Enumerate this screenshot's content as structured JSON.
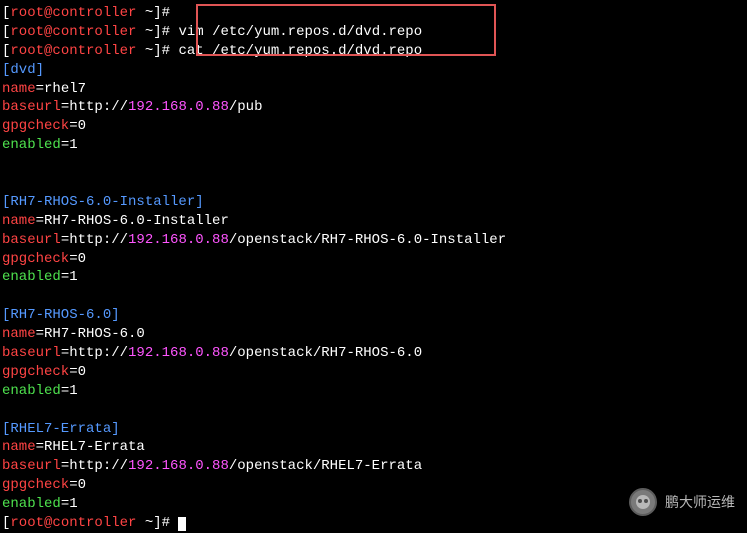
{
  "prompt": {
    "open_bracket": "[",
    "userhost": "root@controller",
    "tilde": " ~",
    "close_prompt": "]# "
  },
  "commands": {
    "empty": "",
    "vim": "vim /etc/yum.repos.d/dvd.repo",
    "cat": "cat /etc/yum.repos.d/dvd.repo"
  },
  "repos": [
    {
      "section": "[dvd]",
      "namekey": "name",
      "nameval": "=rhel7",
      "baseurlkey": "baseurl",
      "baseurlproto": "=http://",
      "baseurlip": "192.168.0.88",
      "baseurlpath": "/pub",
      "gpgkey": "gpgcheck",
      "gpgval": "=0",
      "enkey": "enabled",
      "enval": "=1"
    },
    {
      "section": "[RH7-RHOS-6.0-Installer]",
      "namekey": "name",
      "nameval": "=RH7-RHOS-6.0-Installer",
      "baseurlkey": "baseurl",
      "baseurlproto": "=http://",
      "baseurlip": "192.168.0.88",
      "baseurlpath": "/openstack/RH7-RHOS-6.0-Installer",
      "gpgkey": "gpgcheck",
      "gpgval": "=0",
      "enkey": "enabled",
      "enval": "=1"
    },
    {
      "section": "[RH7-RHOS-6.0]",
      "namekey": "name",
      "nameval": "=RH7-RHOS-6.0",
      "baseurlkey": "baseurl",
      "baseurlproto": "=http://",
      "baseurlip": "192.168.0.88",
      "baseurlpath": "/openstack/RH7-RHOS-6.0",
      "gpgkey": "gpgcheck",
      "gpgval": "=0",
      "enkey": "enabled",
      "enval": "=1"
    },
    {
      "section": "[RHEL7-Errata]",
      "namekey": "name",
      "nameval": "=RHEL7-Errata",
      "baseurlkey": "baseurl",
      "baseurlproto": "=http://",
      "baseurlip": "192.168.0.88",
      "baseurlpath": "/openstack/RHEL7-Errata",
      "gpgkey": "gpgcheck",
      "gpgval": "=0",
      "enkey": "enabled",
      "enval": "=1"
    }
  ],
  "watermark": "鹏大师运维"
}
